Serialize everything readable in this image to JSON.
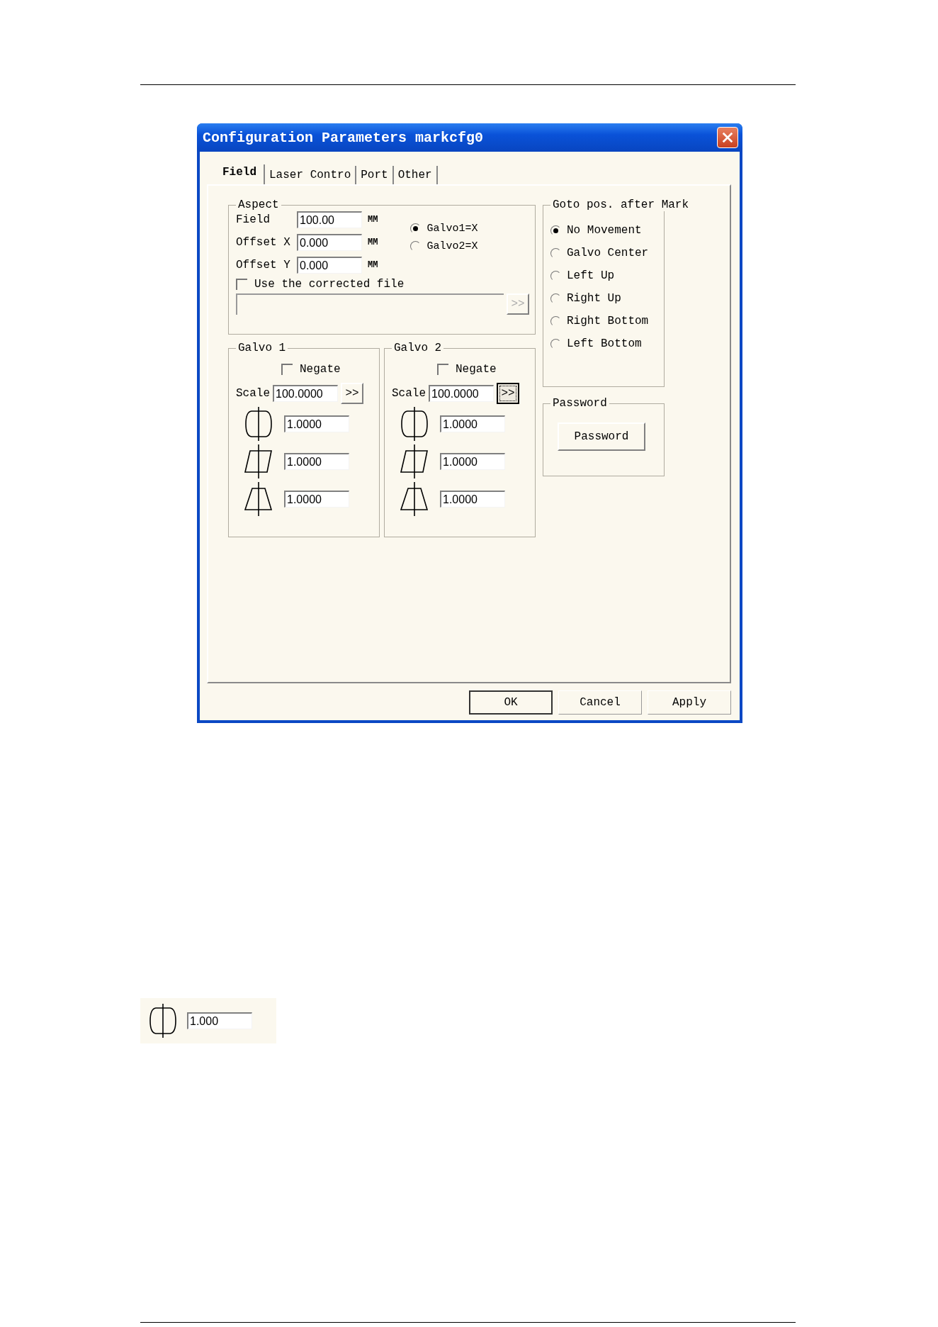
{
  "dialog": {
    "title": "Configuration Parameters markcfg0",
    "tabs": [
      {
        "label": "Field",
        "selected": true
      },
      {
        "label": "Laser Contro",
        "selected": false
      },
      {
        "label": "Port",
        "selected": false
      },
      {
        "label": "Other",
        "selected": false
      }
    ],
    "aspect": {
      "legend": "Aspect",
      "fields": [
        {
          "label": "Field",
          "value": "100.00",
          "unit": "MM"
        },
        {
          "label": "Offset X",
          "value": "0.000",
          "unit": "MM"
        },
        {
          "label": "Offset Y",
          "value": "0.000",
          "unit": "MM"
        }
      ],
      "galvo_options": [
        {
          "label": "Galvo1=X",
          "selected": true
        },
        {
          "label": "Galvo2=X",
          "selected": false
        }
      ],
      "corrected_file": {
        "label": "Use the corrected file",
        "checked": false
      },
      "browse_button": ">>"
    },
    "galvos": [
      {
        "legend": "Galvo 1",
        "negate": {
          "label": "Negate",
          "checked": false
        },
        "scale_label": "Scale",
        "scale_value": "100.0000",
        "scale_button": {
          "label": ">>",
          "focused": false
        },
        "corrections": [
          {
            "kind": "barrel",
            "value": "1.0000"
          },
          {
            "kind": "parallelogram",
            "value": "1.0000"
          },
          {
            "kind": "trapezoid",
            "value": "1.0000"
          }
        ]
      },
      {
        "legend": "Galvo 2",
        "negate": {
          "label": "Negate",
          "checked": false
        },
        "scale_label": "Scale",
        "scale_value": "100.0000",
        "scale_button": {
          "label": ">>",
          "focused": true
        },
        "corrections": [
          {
            "kind": "barrel",
            "value": "1.0000"
          },
          {
            "kind": "parallelogram",
            "value": "1.0000"
          },
          {
            "kind": "trapezoid",
            "value": "1.0000"
          }
        ]
      }
    ],
    "goto": {
      "legend": "Goto pos. after Mark",
      "options": [
        {
          "label": "No Movement",
          "selected": true
        },
        {
          "label": "Galvo Center",
          "selected": false
        },
        {
          "label": "Left Up",
          "selected": false
        },
        {
          "label": "Right Up",
          "selected": false
        },
        {
          "label": "Right Bottom",
          "selected": false
        },
        {
          "label": "Left Bottom",
          "selected": false
        }
      ]
    },
    "password": {
      "legend": "Password",
      "button": "Password"
    },
    "buttons": [
      {
        "label": "OK",
        "default": true
      },
      {
        "label": "Cancel",
        "default": false
      },
      {
        "label": "Apply",
        "default": false
      }
    ]
  },
  "snippet": {
    "kind": "barrel",
    "value": "1.000"
  }
}
